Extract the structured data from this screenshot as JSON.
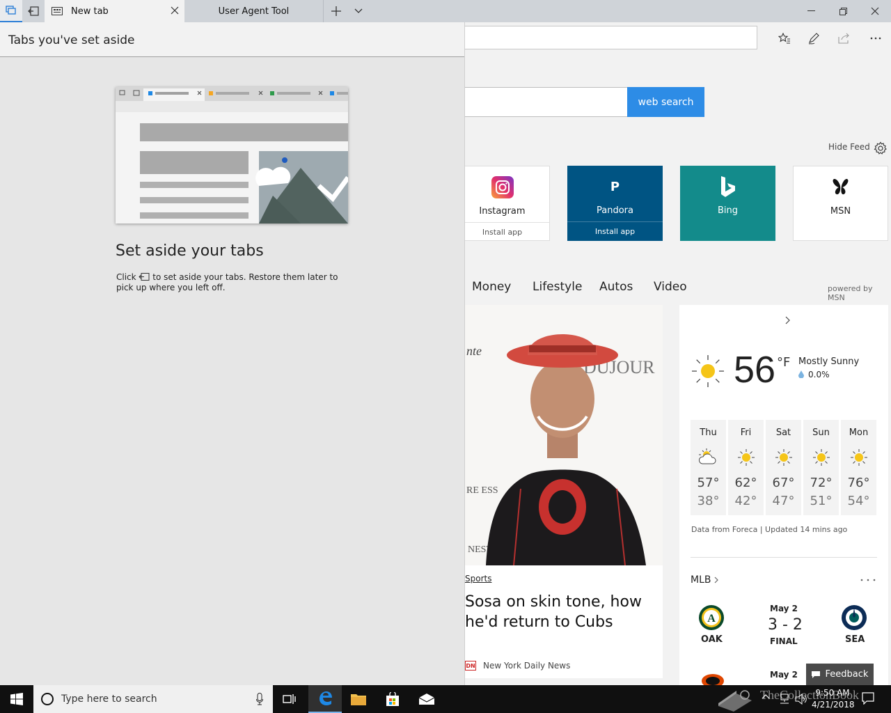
{
  "browser": {
    "tabs": [
      {
        "label": "New tab"
      },
      {
        "label": "User Agent Tool"
      }
    ]
  },
  "page": {
    "search_button": "web search",
    "hide_feed": "Hide Feed",
    "tiles": [
      {
        "name": "Instagram",
        "sub": "Install app",
        "color": "#ffffff"
      },
      {
        "name": "Pandora",
        "sub": "Install app",
        "color": "#005483",
        "letter": "P"
      },
      {
        "name": "Bing",
        "sub": "",
        "color": "#138b8b"
      },
      {
        "name": "MSN",
        "sub": "",
        "color": "#ffffff"
      }
    ],
    "nav": [
      "Money",
      "Lifestyle",
      "Autos",
      "Video"
    ],
    "powered": "powered by MSN",
    "news": {
      "category": "Sports",
      "headline": "Sosa on skin tone, how he'd return to Cubs",
      "source_logo": "DN",
      "source": "New York Daily News"
    },
    "weather": {
      "temp": "56",
      "unit": "°F",
      "condition": "Mostly Sunny",
      "precip": "0.0%",
      "forecast": [
        {
          "day": "Thu",
          "hi": "57°",
          "lo": "38°",
          "icon": "partly-cloudy-icon"
        },
        {
          "day": "Fri",
          "hi": "62°",
          "lo": "42°",
          "icon": "sun-icon"
        },
        {
          "day": "Sat",
          "hi": "67°",
          "lo": "47°",
          "icon": "sun-icon"
        },
        {
          "day": "Sun",
          "hi": "72°",
          "lo": "51°",
          "icon": "sun-icon"
        },
        {
          "day": "Mon",
          "hi": "76°",
          "lo": "54°",
          "icon": "sun-icon"
        }
      ],
      "source": "Data from Foreca | Updated 14 mins ago"
    },
    "mlb": {
      "title": "MLB",
      "game1": {
        "home": "OAK",
        "away": "SEA",
        "date": "May 2",
        "score": "3 - 2",
        "status": "FINAL"
      },
      "game2": {
        "date": "May 2"
      }
    },
    "feedback": "Feedback"
  },
  "panel": {
    "header": "Tabs you've set aside",
    "heading": "Set aside your tabs",
    "desc_click": "Click",
    "desc_rest": "to set aside your tabs. Restore them later to pick up where you left off."
  },
  "taskbar": {
    "search_placeholder": "Type here to search",
    "time": "9:50 AM",
    "date": "4/21/2018",
    "watermark": "TheCollectionBook"
  },
  "colors": {
    "accent": "#2d8ce6",
    "panel_bg": "#e6e6e6"
  }
}
